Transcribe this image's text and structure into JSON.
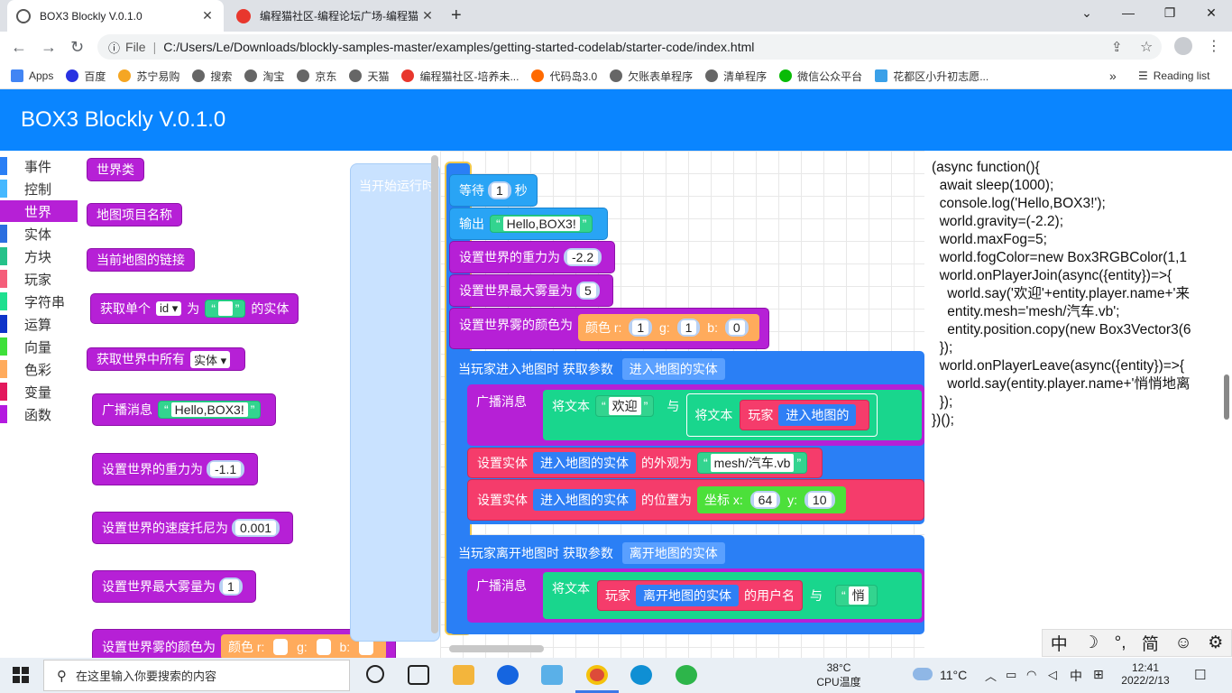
{
  "browser": {
    "tabs": [
      {
        "title": "BOX3 Blockly V.0.1.0"
      },
      {
        "title": "编程猫社区-编程论坛广场-编程猫"
      }
    ],
    "new_tab": "+",
    "window_controls": {
      "minimize": "⌄",
      "min2": "—",
      "restore": "❐",
      "close": "✕"
    },
    "omnibox": {
      "scheme": "File",
      "url": "C:/Users/Le/Downloads/blockly-samples-master/examples/getting-started-codelab/starter-code/index.html"
    },
    "bookmarks": [
      "Apps",
      "百度",
      "苏宁易购",
      "搜索",
      "淘宝",
      "京东",
      "天猫",
      "编程猫社区-培养未...",
      "代码岛3.0",
      "欠账表单程序",
      "清单程序",
      "微信公众平台",
      "花都区小升初志愿..."
    ],
    "bookmark_more": "»",
    "reading_list": "Reading list",
    "colors": {
      "accent": "#0a85ff"
    }
  },
  "app": {
    "title": "BOX3 Blockly V.0.1.0"
  },
  "categories": [
    {
      "label": "事件",
      "color": "#2a7ff5"
    },
    {
      "label": "控制",
      "color": "#45b8ff"
    },
    {
      "label": "世界",
      "color": "#b620d6"
    },
    {
      "label": "实体",
      "color": "#2b6fe0"
    },
    {
      "label": "方块",
      "color": "#26c28a"
    },
    {
      "label": "玩家",
      "color": "#f55e7a"
    },
    {
      "label": "字符串",
      "color": "#1ee08f"
    },
    {
      "label": "运算",
      "color": "#0e34c9"
    },
    {
      "label": "向量",
      "color": "#3ee03a"
    },
    {
      "label": "色彩",
      "color": "#ffab5c"
    },
    {
      "label": "变量",
      "color": "#e3185c"
    },
    {
      "label": "函数",
      "color": "#b41ae0"
    }
  ],
  "flyout": {
    "world_class": "世界类",
    "map_name": "地图项目名称",
    "map_link": "当前地图的链接",
    "get_single_a": "获取单个",
    "get_single_id": "id",
    "get_single_b": "为",
    "get_single_c": "的实体",
    "get_all": "获取世界中所有",
    "get_all_opt": "实体",
    "broadcast": "广播消息",
    "broadcast_val": "Hello,BOX3!",
    "gravity": "设置世界的重力为",
    "gravity_val": "-1.1",
    "damping": "设置世界的速度托尼为",
    "damping_val": "0.001",
    "fog": "设置世界最大雾量为",
    "fog_val": "1",
    "fog_color": "设置世界雾的颜色为",
    "color_r": "颜色 r:",
    "g": "g:",
    "b": "b:",
    "hat_label": "当开始运行时"
  },
  "workspace": {
    "wait": "等待",
    "wait_val": "1",
    "sec": "秒",
    "output": "输出",
    "output_val": "Hello,BOX3!",
    "gravity": "设置世界的重力为",
    "gravity_val": "-2.2",
    "fog": "设置世界最大雾量为",
    "fog_val": "5",
    "fog_color": "设置世界雾的颜色为",
    "color_r": "颜色 r:",
    "r_val": "1",
    "g": "g:",
    "g_val": "1",
    "b": "b:",
    "b_val": "0",
    "join": "当玩家进入地图时 获取参数",
    "join_var": "进入地图的实体",
    "broadcast": "广播消息",
    "text_a": "将文本",
    "welcome": "欢迎",
    "and": "与",
    "text_b": "将文本",
    "player": "玩家",
    "join_var2": "进入地图的",
    "set_entity": "设置实体",
    "appearance": "的外观为",
    "mesh": "mesh/汽车.vb",
    "position": "的位置为",
    "coord_x": "坐标 x:",
    "x_val": "64",
    "coord_y": "y:",
    "y_val": "10",
    "leave": "当玩家离开地图时 获取参数",
    "leave_var": "离开地图的实体",
    "leave_broadcast": "广播消息",
    "leave_text": "将文本",
    "leave_player": "玩家",
    "leave_var2": "离开地图的实体",
    "username": "的用户名",
    "and2": "与",
    "quiet": "悄"
  },
  "code_lines": [
    "(async function(){",
    "  await sleep(1000);",
    "  console.log('Hello,BOX3!');",
    "  world.gravity=(-2.2);",
    "  world.maxFog=5;",
    "  world.fogColor=new Box3RGBColor(1,1",
    "  world.onPlayerJoin(async({entity})=>{",
    "    world.say('欢迎'+entity.player.name+'来",
    "    entity.mesh='mesh/汽车.vb';",
    "    entity.position.copy(new Box3Vector3(6",
    "  });",
    "  world.onPlayerLeave(async({entity})=>{",
    "    world.say(entity.player.name+'悄悄地离",
    "  });",
    "})();"
  ],
  "ime": [
    "中",
    "☽",
    "°,",
    "简",
    "☺",
    "⚙"
  ],
  "taskbar": {
    "search_placeholder": "在这里输入你要搜索的内容",
    "cpu_temp": "38°C",
    "cpu_label": "CPU温度",
    "weather": "11°C",
    "lang": "中",
    "time": "12:41",
    "date": "2022/2/13"
  }
}
